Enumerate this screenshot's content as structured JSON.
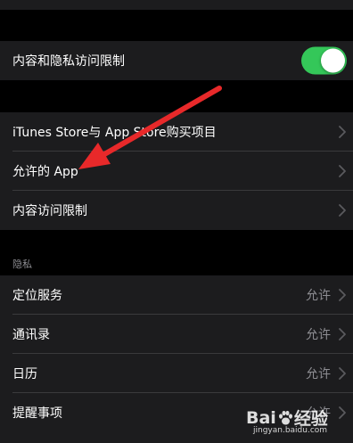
{
  "screen_time": {
    "content_privacy": {
      "label": "内容和隐私访问限制",
      "enabled": true
    },
    "store_group": [
      {
        "label": "iTunes Store与 App Store购买项目"
      },
      {
        "label": "允许的 App"
      },
      {
        "label": "内容访问限制"
      }
    ],
    "privacy_header": "隐私",
    "privacy_group": [
      {
        "label": "定位服务",
        "value": "允许"
      },
      {
        "label": "通讯录",
        "value": "允许"
      },
      {
        "label": "日历",
        "value": "允许"
      },
      {
        "label": "提醒事项",
        "value": "允许"
      }
    ]
  },
  "watermark": {
    "main": "Bai",
    "main_suffix": "经验",
    "sub": "jingyan.baidu.com"
  },
  "colors": {
    "background": "#000000",
    "cell": "#1c1c1e",
    "separator": "#3a3a3c",
    "toggle_on": "#34c759",
    "secondary_text": "#8e8e93",
    "annotation_arrow": "#e8292a"
  },
  "icons": {
    "disclosure": "chevron-right-icon",
    "annotation": "red-arrow-icon",
    "watermark_logo": "baidu-paw-icon"
  }
}
